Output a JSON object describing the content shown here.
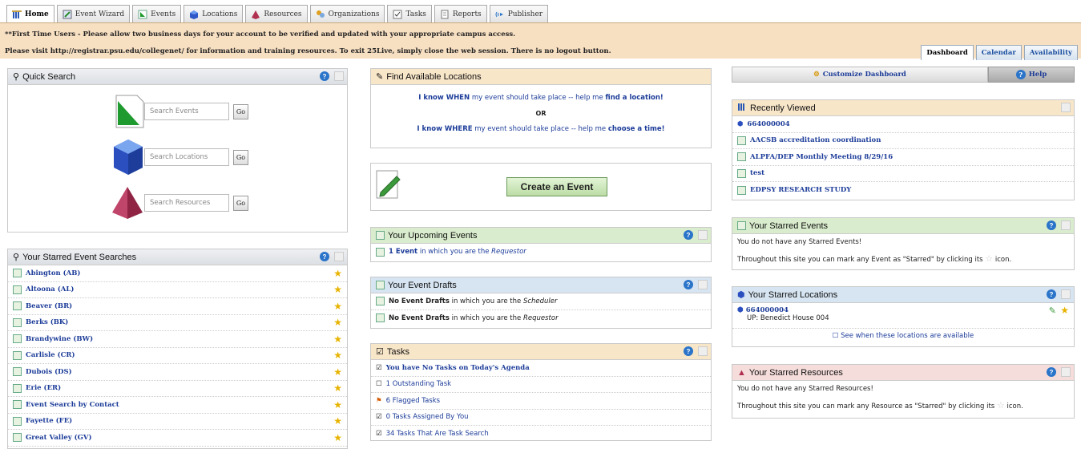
{
  "tabs": [
    {
      "label": "Home",
      "icon": "home-icon"
    },
    {
      "label": "Event Wizard",
      "icon": "wizard-icon"
    },
    {
      "label": "Events",
      "icon": "events-icon"
    },
    {
      "label": "Locations",
      "icon": "locations-icon"
    },
    {
      "label": "Resources",
      "icon": "resources-icon"
    },
    {
      "label": "Organizations",
      "icon": "organizations-icon"
    },
    {
      "label": "Tasks",
      "icon": "tasks-icon"
    },
    {
      "label": "Reports",
      "icon": "reports-icon"
    },
    {
      "label": "Publisher",
      "icon": "publisher-icon"
    }
  ],
  "banner": {
    "line1": "**First Time Users - Please allow two business days for your account to be verified and updated with your appropriate campus access.",
    "line2": "Please visit http://registrar.psu.edu/collegenet/ for information and training resources. To exit 25Live, simply close the web session. There is no logout button."
  },
  "subtabs": [
    "Dashboard",
    "Calendar",
    "Availability"
  ],
  "quick_search": {
    "title": "Quick Search",
    "events_placeholder": "Search Events",
    "locations_placeholder": "Search Locations",
    "resources_placeholder": "Search Resources",
    "go_label": "Go"
  },
  "starred_searches": {
    "title": "Your Starred Event Searches",
    "items": [
      "Abington (AB)",
      "Altoona (AL)",
      "Beaver (BR)",
      "Berks (BK)",
      "Brandywine (BW)",
      "Carlisle (CR)",
      "Dubois (DS)",
      "Erie (ER)",
      "Event Search by Contact",
      "Fayette (FE)",
      "Great Valley (GV)"
    ]
  },
  "find_locations": {
    "title": "Find Available Locations",
    "when_1": "I know WHEN",
    "when_2": "my event should take place -- help me",
    "when_3": "find a location!",
    "or": "OR",
    "where_1": "I know WHERE",
    "where_2": "my event should take place -- help me",
    "where_3": "choose a time!"
  },
  "create_event": {
    "label": "Create an Event"
  },
  "upcoming": {
    "title": "Your Upcoming Events",
    "count": "1 Event",
    "text": "in which you are the",
    "role": "Requestor"
  },
  "drafts": {
    "title": "Your Event Drafts",
    "rows": [
      {
        "bold": "No Event Drafts",
        "text": "in which you are the",
        "role": "Scheduler"
      },
      {
        "bold": "No Event Drafts",
        "text": "in which you are the",
        "role": "Requestor"
      }
    ]
  },
  "tasks": {
    "title": "Tasks",
    "rows": [
      "You have No Tasks on Today's Agenda",
      "1 Outstanding Task",
      "6 Flagged Tasks",
      "0 Tasks Assigned By You",
      "34 Tasks That Are Task Search"
    ]
  },
  "dash_bar": {
    "customize": "Customize Dashboard",
    "help": "Help"
  },
  "recent": {
    "title": "Recently Viewed",
    "items": [
      "664000004",
      "AACSB accreditation coordination",
      "ALPFA/DEP Monthly Meeting 8/29/16",
      "test",
      "EDPSY RESEARCH STUDY"
    ]
  },
  "starred_events": {
    "title": "Your Starred Events",
    "line1": "You do not have any Starred Events!",
    "line2a": "Throughout this site you can mark any Event as \"Starred\" by clicking its",
    "line2b": "icon."
  },
  "starred_locations": {
    "title": "Your Starred Locations",
    "item": "664000004",
    "sub": "UP: Benedict House 004",
    "see": "See when these locations are available"
  },
  "starred_resources": {
    "title": "Your Starred Resources",
    "line1": "You do not have any Starred Resources!",
    "line2a": "Throughout this site you can mark any Resource as \"Starred\" by clicking its",
    "line2b": "icon."
  }
}
